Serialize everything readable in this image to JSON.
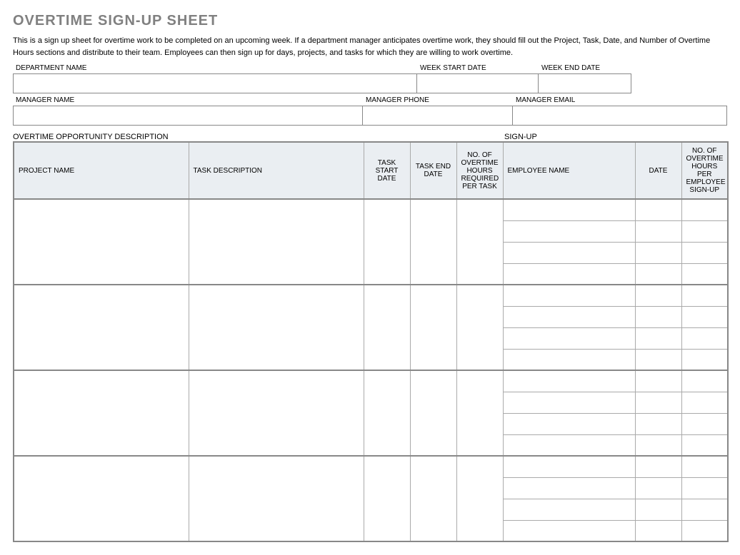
{
  "title": "OVERTIME SIGN-UP SHEET",
  "intro": "This is a sign up sheet for overtime work to be completed on an upcoming week. If a department manager anticipates overtime work, they should fill out the Project, Task, Date, and Number of Overtime Hours sections and distribute to their team. Employees can then sign up for days, projects, and tasks for which they are willing to work overtime.",
  "fields": {
    "department_name_label": "DEPARTMENT NAME",
    "week_start_label": "WEEK START DATE",
    "week_end_label": "WEEK END DATE",
    "manager_name_label": "MANAGER NAME",
    "manager_phone_label": "MANAGER PHONE",
    "manager_email_label": "MANAGER EMAIL",
    "department_name": "",
    "week_start": "",
    "week_end": "",
    "manager_name": "",
    "manager_phone": "",
    "manager_email": ""
  },
  "sections": {
    "opportunity": "OVERTIME OPPORTUNITY DESCRIPTION",
    "signup": "SIGN-UP"
  },
  "columns": {
    "project": "PROJECT NAME",
    "task": "TASK DESCRIPTION",
    "task_start": "TASK START DATE",
    "task_end": "TASK END DATE",
    "hours_required": "NO. OF OVERTIME HOURS REQUIRED PER TASK",
    "employee": "EMPLOYEE NAME",
    "date": "DATE",
    "hours_per_signup": "NO. OF OVERTIME HOURS PER EMPLOYEE SIGN-UP"
  },
  "groups": [
    {
      "project": "",
      "task": "",
      "task_start": "",
      "task_end": "",
      "hours_required": "",
      "signups": [
        {
          "employee": "",
          "date": "",
          "hours": ""
        },
        {
          "employee": "",
          "date": "",
          "hours": ""
        },
        {
          "employee": "",
          "date": "",
          "hours": ""
        },
        {
          "employee": "",
          "date": "",
          "hours": ""
        }
      ]
    },
    {
      "project": "",
      "task": "",
      "task_start": "",
      "task_end": "",
      "hours_required": "",
      "signups": [
        {
          "employee": "",
          "date": "",
          "hours": ""
        },
        {
          "employee": "",
          "date": "",
          "hours": ""
        },
        {
          "employee": "",
          "date": "",
          "hours": ""
        },
        {
          "employee": "",
          "date": "",
          "hours": ""
        }
      ]
    },
    {
      "project": "",
      "task": "",
      "task_start": "",
      "task_end": "",
      "hours_required": "",
      "signups": [
        {
          "employee": "",
          "date": "",
          "hours": ""
        },
        {
          "employee": "",
          "date": "",
          "hours": ""
        },
        {
          "employee": "",
          "date": "",
          "hours": ""
        },
        {
          "employee": "",
          "date": "",
          "hours": ""
        }
      ]
    },
    {
      "project": "",
      "task": "",
      "task_start": "",
      "task_end": "",
      "hours_required": "",
      "signups": [
        {
          "employee": "",
          "date": "",
          "hours": ""
        },
        {
          "employee": "",
          "date": "",
          "hours": ""
        },
        {
          "employee": "",
          "date": "",
          "hours": ""
        },
        {
          "employee": "",
          "date": "",
          "hours": ""
        }
      ]
    }
  ]
}
